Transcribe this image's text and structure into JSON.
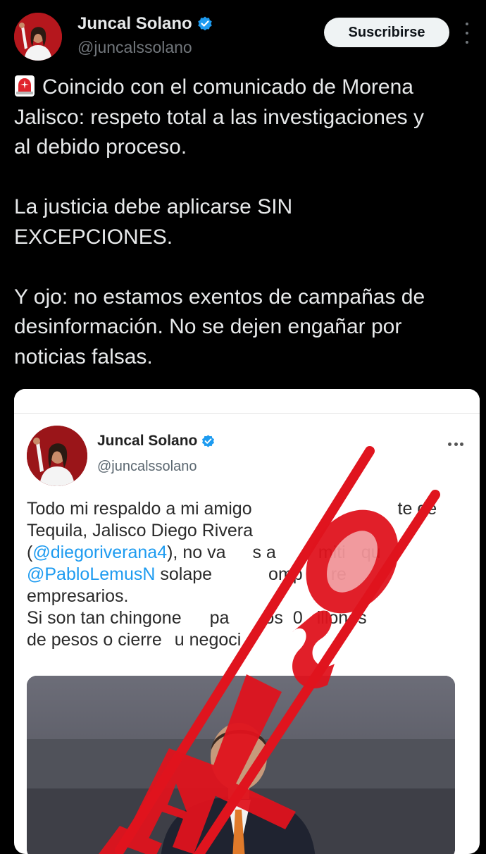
{
  "author": {
    "name": "Juncal Solano",
    "handle": "@juncalssolano",
    "verified": true,
    "avatar": "profile-photo-icon"
  },
  "header": {
    "subscribe_label": "Suscribirse",
    "more_icon": "more-vertical-icon"
  },
  "post": {
    "alarm_icon": "rotating-light-emoji",
    "paragraphs": [
      [
        "Coincido con el comunicado de Morena",
        "Jalisco: respeto total a las investigaciones y",
        "al debido proceso."
      ],
      [
        "La justicia debe aplicarse SIN",
        "EXCEPCIONES."
      ],
      [
        "Y ojo: no estamos exentos de campañas de",
        "desinformación. No se dejen engañar por",
        "noticias falsas."
      ]
    ]
  },
  "quoted_screenshot": {
    "name": "Juncal Solano",
    "handle": "@juncalssolano",
    "more_icon": "more-horizontal-icon",
    "lines": [
      "Todo mi respaldo a mi amigo (",
      "Tequila, Jalisco Diego River",
      "(@diegoriverana4), no va",
      "@PabloLemusN solape",
      "empresarios.",
      "Si son tan chingone",
      "de pesos o cierre"
    ],
    "line_parts": {
      "l1a": "Todo mi respaldo a mi amigo ",
      "l1b": "te de",
      "l2": "Tequila, Jalisco Diego Rivera",
      "l3_mention": "@diegoriverana4",
      "l3a": "), no va",
      "l3b": "s a",
      "l3c": "miti",
      "l3d": "qu",
      "l4_mention": "@PabloLemusN",
      "l4a": " solape",
      "l4b": "omp",
      "l4c": "re",
      "l5": "empresarios.",
      "l6a": "Si son tan chingone",
      "l6b": "pa",
      "l6c": "os",
      "l6d": "0",
      "l6e": "illones",
      "l7a": "de pesos o cierre",
      "l7b": "u negoci"
    },
    "stamp_text": "FALSO",
    "stamp_color": "#e0141e"
  },
  "colors": {
    "background": "#000000",
    "text_primary": "#e7e9ea",
    "text_secondary": "#71767b",
    "verified": "#1d9bf0",
    "link": "#1d9bf0"
  }
}
